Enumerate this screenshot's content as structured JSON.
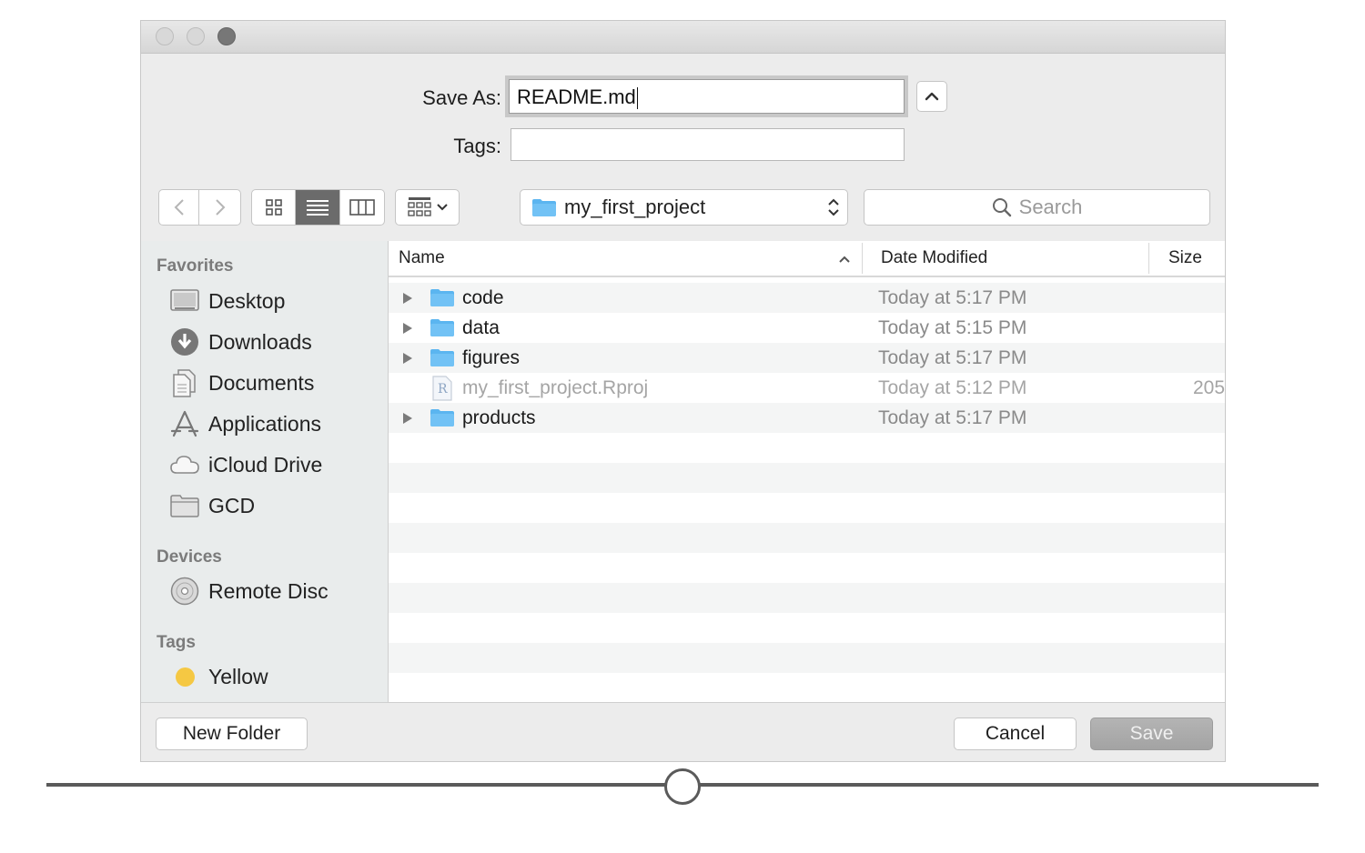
{
  "dialog": {
    "save_as_label": "Save As:",
    "save_as_value": "README.md",
    "tags_label": "Tags:",
    "tags_value": ""
  },
  "toolbar": {
    "location": "my_first_project",
    "search_placeholder": "Search",
    "active_view": "list"
  },
  "sidebar": {
    "favorites_header": "Favorites",
    "favorites": [
      {
        "label": "Desktop",
        "icon": "desktop-icon"
      },
      {
        "label": "Downloads",
        "icon": "downloads-icon"
      },
      {
        "label": "Documents",
        "icon": "documents-icon"
      },
      {
        "label": "Applications",
        "icon": "applications-icon"
      },
      {
        "label": "iCloud Drive",
        "icon": "cloud-icon"
      },
      {
        "label": "GCD",
        "icon": "folder-icon"
      }
    ],
    "devices_header": "Devices",
    "devices": [
      {
        "label": "Remote Disc",
        "icon": "disc-icon"
      }
    ],
    "tags_header": "Tags",
    "tags": [
      {
        "label": "Yellow",
        "color": "#f5c843"
      }
    ]
  },
  "file_list": {
    "columns": {
      "name": "Name",
      "date": "Date Modified",
      "size": "Size"
    },
    "rows": [
      {
        "name": "code",
        "date": "Today at 5:17 PM",
        "size": "",
        "kind": "folder"
      },
      {
        "name": "data",
        "date": "Today at 5:15 PM",
        "size": "",
        "kind": "folder"
      },
      {
        "name": "figures",
        "date": "Today at 5:17 PM",
        "size": "",
        "kind": "folder"
      },
      {
        "name": "my_first_project.Rproj",
        "date": "Today at 5:12 PM",
        "size": "205",
        "kind": "file"
      },
      {
        "name": "products",
        "date": "Today at 5:17 PM",
        "size": "",
        "kind": "folder"
      }
    ]
  },
  "footer": {
    "new_folder": "New Folder",
    "cancel": "Cancel",
    "save": "Save"
  },
  "colors": {
    "folder": "#5bb5f0",
    "selected_view": "#6b6b6b",
    "save_button": "#a8a8a8"
  }
}
